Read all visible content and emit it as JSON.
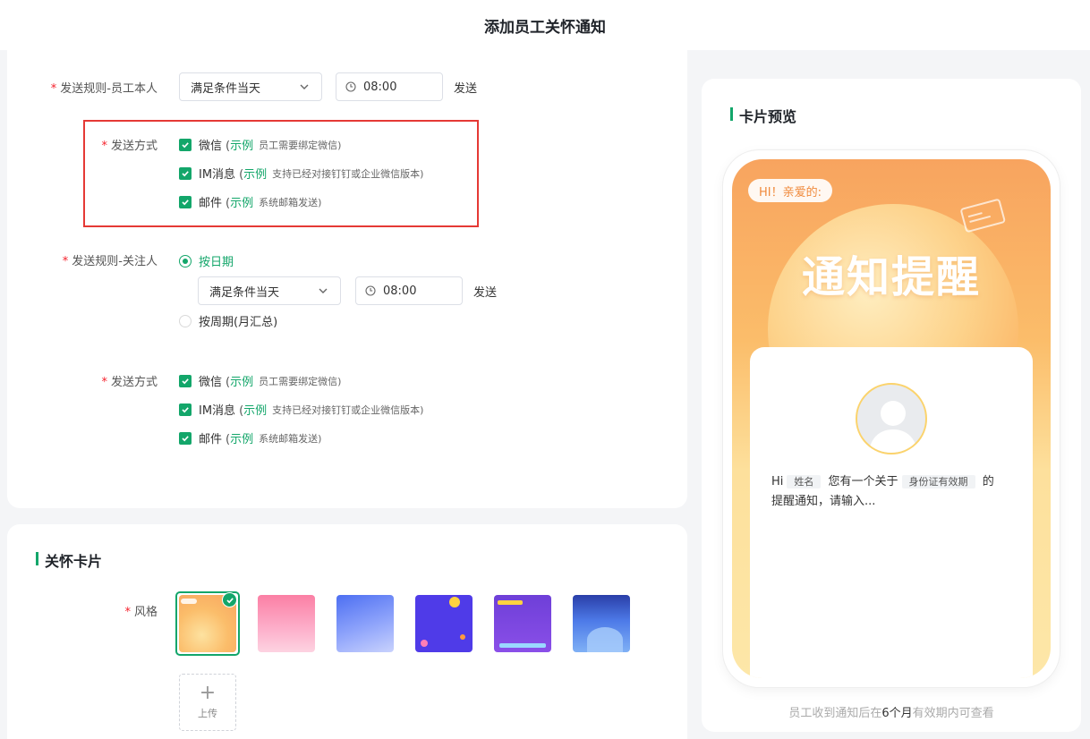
{
  "header": {
    "title": "添加员工关怀通知"
  },
  "rule_employee": {
    "label": "发送规则-员工本人",
    "select": "满足条件当天",
    "time": "08:00",
    "suffix": "发送"
  },
  "send_method_1": {
    "label": "发送方式",
    "options": [
      {
        "name": "微信",
        "example": "示例",
        "hint": "员工需要绑定微信)",
        "checked": true
      },
      {
        "name": "IM消息",
        "example": "示例",
        "hint": "支持已经对接钉钉或企业微信版本)",
        "checked": true
      },
      {
        "name": "邮件",
        "example": "示例",
        "hint": "系统邮箱发送)",
        "checked": true
      }
    ]
  },
  "rule_follower": {
    "label": "发送规则-关注人",
    "radio_date": "按日期",
    "select": "满足条件当天",
    "time": "08:00",
    "suffix": "发送",
    "radio_period": "按周期(月汇总)"
  },
  "send_method_2": {
    "label": "发送方式",
    "options": [
      {
        "name": "微信",
        "example": "示例",
        "hint": "员工需要绑定微信)",
        "checked": true
      },
      {
        "name": "IM消息",
        "example": "示例",
        "hint": "支持已经对接钉钉或企业微信版本)",
        "checked": true
      },
      {
        "name": "邮件",
        "example": "示例",
        "hint": "系统邮箱发送)",
        "checked": true
      }
    ]
  },
  "care_card": {
    "title": "关怀卡片",
    "style_label": "风格",
    "upload_label": "上传",
    "selected_index": 0
  },
  "preview": {
    "title": "卡片预览",
    "hi": "HI！亲爱的:",
    "big_title": "通知提醒",
    "msg_hi": "Hi",
    "tag_name": "姓名",
    "msg_mid": "您有一个关于",
    "tag_item": "身份证有效期",
    "msg_de": "的",
    "msg_tail": "提醒通知，请输入...",
    "foot_pre": "员工收到通知后在",
    "foot_value": "6个月",
    "foot_post": "有效期内可查看"
  },
  "colors": {
    "accent": "#13a66a",
    "required": "#f5222d",
    "highlight_box": "#e53935",
    "card_orange": "#f8a45f"
  }
}
